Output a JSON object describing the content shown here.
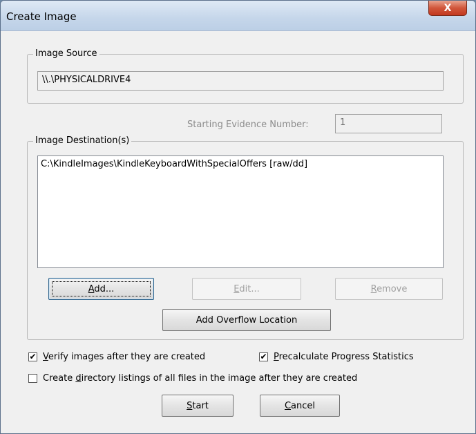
{
  "window": {
    "title": "Create Image",
    "close_glyph": "X"
  },
  "image_source": {
    "legend": "Image Source",
    "value": "\\\\.\\PHYSICALDRIVE4"
  },
  "evidence": {
    "label": "Starting Evidence Number:",
    "value": "1"
  },
  "destinations": {
    "legend": "Image Destination(s)",
    "items": [
      "C:\\KindleImages\\KindleKeyboardWithSpecialOffers [raw/dd]"
    ]
  },
  "buttons": {
    "add": {
      "pre": "",
      "key": "A",
      "post": "dd..."
    },
    "edit": {
      "pre": "",
      "key": "E",
      "post": "dit..."
    },
    "remove": {
      "pre": "",
      "key": "R",
      "post": "emove"
    },
    "overflow": "Add Overflow Location",
    "start": {
      "pre": "",
      "key": "S",
      "post": "tart"
    },
    "cancel": {
      "pre": "",
      "key": "C",
      "post": "ancel"
    }
  },
  "options": {
    "verify": {
      "pre": "",
      "key": "V",
      "post": "erify images after they are created",
      "checked": true
    },
    "precalc": {
      "pre": "",
      "key": "P",
      "post": "recalculate Progress Statistics",
      "checked": true
    },
    "listings": {
      "pre": "Create ",
      "key": "d",
      "post": "irectory listings of all files in the image after they are created",
      "checked": false
    }
  }
}
